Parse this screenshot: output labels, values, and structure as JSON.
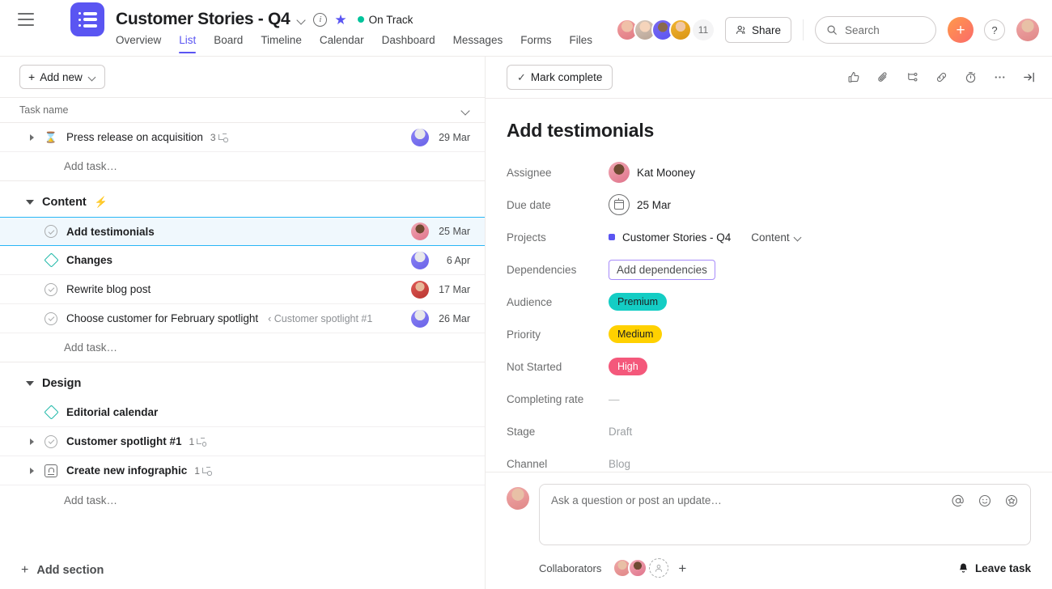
{
  "header": {
    "project_title": "Customer Stories - Q4",
    "status_label": "On Track",
    "status_color": "#00c39b",
    "brand_color": "#5a55f2",
    "member_count": "11",
    "share_label": "Share",
    "search_placeholder": "Search",
    "plus_label": "+",
    "help_label": "?",
    "tabs": [
      {
        "label": "Overview",
        "active": false
      },
      {
        "label": "List",
        "active": true
      },
      {
        "label": "Board",
        "active": false
      },
      {
        "label": "Timeline",
        "active": false
      },
      {
        "label": "Calendar",
        "active": false
      },
      {
        "label": "Dashboard",
        "active": false
      },
      {
        "label": "Messages",
        "active": false
      },
      {
        "label": "Forms",
        "active": false
      },
      {
        "label": "Files",
        "active": false
      }
    ]
  },
  "list": {
    "add_new_label": "Add new",
    "column_header": "Task name",
    "add_task_label": "Add task…",
    "add_section_label": "Add section",
    "rows": [
      {
        "type": "task",
        "caret": true,
        "icon": "hourglass-icon",
        "name": "Press release on acquisition",
        "bold": false,
        "subtasks": "3",
        "parent_ref": "",
        "date": "29 Mar",
        "avatar": "ph-f",
        "selected": false
      },
      {
        "type": "add-task",
        "label": "Add task…"
      },
      {
        "type": "section",
        "name": "Content",
        "bolt": "⚡"
      },
      {
        "type": "task",
        "caret": false,
        "icon": "check-circle-icon",
        "name": "Add testimonials",
        "bold": true,
        "subtasks": "",
        "parent_ref": "",
        "date": "25 Mar",
        "avatar": "ph-e",
        "selected": true
      },
      {
        "type": "task",
        "caret": false,
        "icon": "milestone-diamond-icon",
        "name": "Changes",
        "bold": true,
        "subtasks": "",
        "parent_ref": "",
        "date": "6 Apr",
        "avatar": "ph-f",
        "selected": false
      },
      {
        "type": "task",
        "caret": false,
        "icon": "check-circle-icon",
        "name": "Rewrite blog post",
        "bold": false,
        "subtasks": "",
        "parent_ref": "",
        "date": "17 Mar",
        "avatar": "ph-g",
        "selected": false
      },
      {
        "type": "task",
        "caret": false,
        "icon": "check-circle-icon",
        "name": "Choose customer for February spotlight",
        "bold": false,
        "subtasks": "",
        "parent_ref": "‹ Customer spotlight #1",
        "date": "26 Mar",
        "avatar": "ph-f",
        "selected": false
      },
      {
        "type": "add-task",
        "label": "Add task…"
      },
      {
        "type": "section",
        "name": "Design",
        "bolt": ""
      },
      {
        "type": "task",
        "caret": false,
        "icon": "milestone-diamond-icon",
        "name": "Editorial calendar",
        "bold": true,
        "subtasks": "",
        "parent_ref": "",
        "date": "",
        "avatar": "",
        "selected": false
      },
      {
        "type": "task",
        "caret": true,
        "icon": "check-circle-icon",
        "name": "Customer spotlight #1",
        "bold": true,
        "subtasks": "1",
        "parent_ref": "",
        "date": "",
        "avatar": "",
        "selected": false
      },
      {
        "type": "task",
        "caret": true,
        "icon": "approval-icon",
        "name": "Create new infographic",
        "bold": true,
        "subtasks": "1",
        "parent_ref": "",
        "date": "",
        "avatar": "",
        "selected": false
      },
      {
        "type": "add-task",
        "label": "Add task…"
      }
    ]
  },
  "detail": {
    "mark_complete_label": "Mark complete",
    "task_title": "Add testimonials",
    "toolbar_icons": [
      "thumbs-up-icon",
      "paperclip-icon",
      "subtask-icon",
      "link-icon",
      "timer-icon",
      "more-options-icon",
      "collapse-panel-icon"
    ],
    "fields": [
      {
        "label": "Assignee",
        "kind": "assignee",
        "value": "Kat Mooney"
      },
      {
        "label": "Due date",
        "kind": "date",
        "value": "25 Mar"
      },
      {
        "label": "Projects",
        "kind": "project",
        "value": "Customer Stories - Q4",
        "section": "Content"
      },
      {
        "label": "Dependencies",
        "kind": "button",
        "value": "Add dependencies"
      },
      {
        "label": "Audience",
        "kind": "pill",
        "value": "Premium",
        "bg": "#14cdc4",
        "fg": "#1e1f21"
      },
      {
        "label": "Priority",
        "kind": "pill",
        "value": "Medium",
        "bg": "#ffd100",
        "fg": "#1e1f21"
      },
      {
        "label": "Not Started",
        "kind": "pill",
        "value": "High",
        "bg": "#f4587b",
        "fg": "#ffffff"
      },
      {
        "label": "Completing rate",
        "kind": "dash",
        "value": "—"
      },
      {
        "label": "Stage",
        "kind": "muted",
        "value": "Draft"
      },
      {
        "label": "Channel",
        "kind": "muted",
        "value": "Blog"
      }
    ],
    "comment_placeholder": "Ask a question or post an update…",
    "comment_icons": [
      "mention-icon",
      "emoji-icon",
      "sticker-icon"
    ],
    "collaborators_label": "Collaborators",
    "add_collaborator_label": "+",
    "leave_task_label": "Leave task"
  }
}
